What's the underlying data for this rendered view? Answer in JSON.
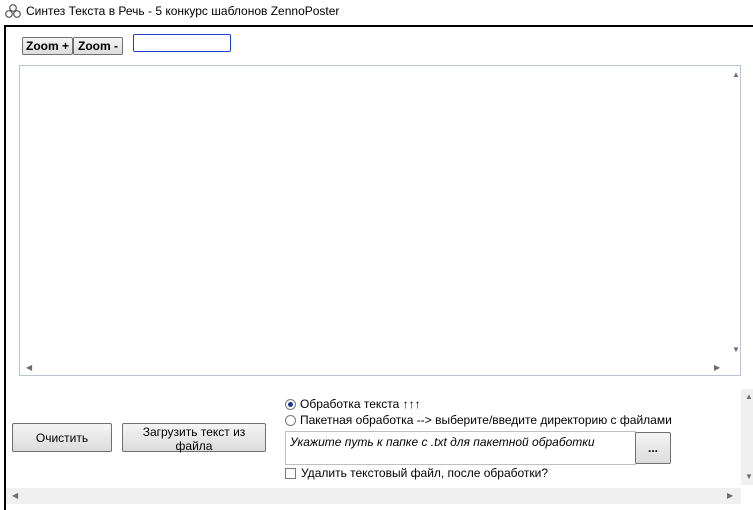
{
  "window": {
    "title": "Синтез Текста в Речь - 5 конкурс шаблонов ZennoPoster"
  },
  "toolbar": {
    "zoom_in_label": "Zoom +",
    "zoom_out_label": "Zoom -",
    "zoom_value": ""
  },
  "editor": {
    "text": ""
  },
  "actions": {
    "clear_label": "Очистить",
    "load_file_label": "Загрузить текст из файла"
  },
  "mode": {
    "text_processing_label": "Обработка текста ↑↑↑",
    "batch_processing_label": "Пакетная обработка --> выберите/введите директорию с файлами",
    "selected": "text_processing"
  },
  "batch": {
    "path_placeholder": "Укажите путь к папке с .txt для пакетной обработки",
    "browse_label": "...",
    "delete_after_label": "Удалить текстовый файл, после обработки?",
    "delete_after_checked": false
  },
  "icons": {
    "app": "triangle-circles-icon",
    "scroll_up": "arrow-up-icon",
    "scroll_down": "arrow-down-icon",
    "scroll_left": "arrow-left-icon",
    "scroll_right": "arrow-right-icon"
  }
}
